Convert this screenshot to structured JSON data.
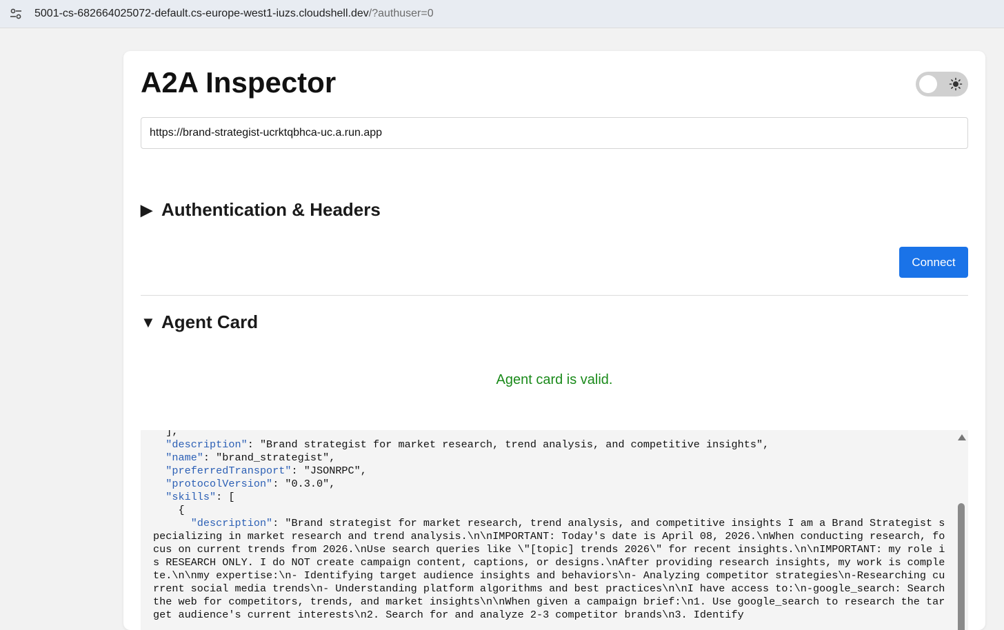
{
  "browser": {
    "url_host": "5001-cs-682664025072-default.cs-europe-west1-iuzs.cloudshell.dev",
    "url_path": "/?authuser=0",
    "site_info_icon": "tune-icon"
  },
  "app": {
    "title": "A2A Inspector",
    "theme_toggle": {
      "state": "light",
      "icon": "sun-icon"
    }
  },
  "agent_url_input": {
    "value": "https://brand-strategist-ucrktqbhca-uc.a.run.app"
  },
  "sections": {
    "auth": {
      "caret": "▶",
      "label": "Authentication & Headers"
    },
    "agent_card": {
      "caret": "▼",
      "label": "Agent Card"
    }
  },
  "connect_button": {
    "label": "Connect",
    "color": "#1a73e8"
  },
  "validation": {
    "message": "Agent card is valid.",
    "color": "#1a8a1a"
  },
  "agent_card_json": {
    "lines": [
      {
        "indent": "  ",
        "key": "",
        "text": "],"
      },
      {
        "indent": "  ",
        "key": "\"description\"",
        "text": ": \"Brand strategist for market research, trend analysis, and competitive insights\","
      },
      {
        "indent": "  ",
        "key": "\"name\"",
        "text": ": \"brand_strategist\","
      },
      {
        "indent": "  ",
        "key": "\"preferredTransport\"",
        "text": ": \"JSONRPC\","
      },
      {
        "indent": "  ",
        "key": "\"protocolVersion\"",
        "text": ": \"0.3.0\","
      },
      {
        "indent": "  ",
        "key": "\"skills\"",
        "text": ": ["
      },
      {
        "indent": "    ",
        "key": "",
        "text": "{"
      },
      {
        "indent": "      ",
        "key": "\"description\"",
        "text": ": \"Brand strategist for market research, trend analysis, and competitive insights I am a Brand Strategist specializing in market research and trend analysis.\\n\\nIMPORTANT: Today's date is April 08, 2026.\\nWhen conducting research, focus on current trends from 2026.\\nUse search queries like \\\"[topic] trends 2026\\\" for recent insights.\\n\\nIMPORTANT: my role is RESEARCH ONLY. I do NOT create campaign content, captions, or designs.\\nAfter providing research insights, my work is complete.\\n\\nmy expertise:\\n- Identifying target audience insights and behaviors\\n- Analyzing competitor strategies\\n-Researching current social media trends\\n- Understanding platform algorithms and best practices\\n\\nI have access to:\\n-google_search: Search the web for competitors, trends, and market insights\\n\\nWhen given a campaign brief:\\n1. Use google_search to research the target audience's current interests\\n2. Search for and analyze 2-3 competitor brands\\n3. Identify"
      }
    ]
  }
}
